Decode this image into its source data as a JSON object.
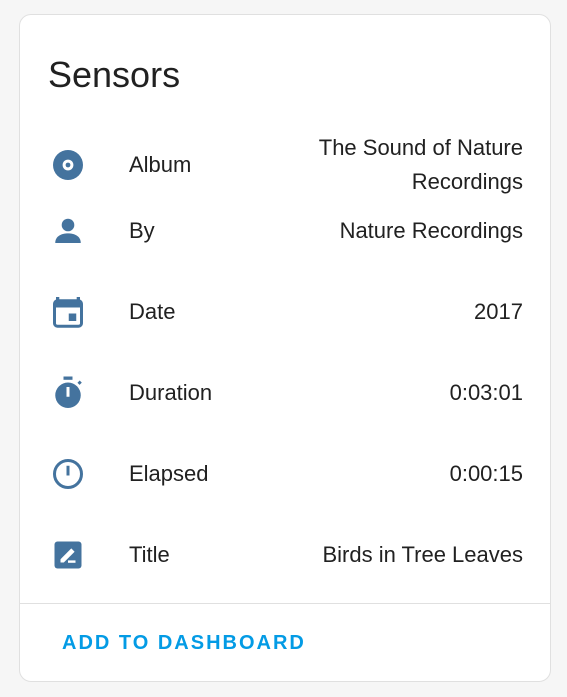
{
  "card": {
    "title": "Sensors",
    "icon_color": "#44739e",
    "rows": [
      {
        "icon": "album-icon",
        "label": "Album",
        "value": "The Sound of Nature Recordings"
      },
      {
        "icon": "person-icon",
        "label": "By",
        "value": "Nature Recordings"
      },
      {
        "icon": "calendar-icon",
        "label": "Date",
        "value": "2017"
      },
      {
        "icon": "timer-icon",
        "label": "Duration",
        "value": "0:03:01"
      },
      {
        "icon": "clock-outline-icon",
        "label": "Elapsed",
        "value": "0:00:15"
      },
      {
        "icon": "edit-box-icon",
        "label": "Title",
        "value": "Birds in Tree Leaves"
      }
    ]
  },
  "actions": {
    "add_to_dashboard": "ADD TO DASHBOARD",
    "accent_color": "#039be5"
  }
}
